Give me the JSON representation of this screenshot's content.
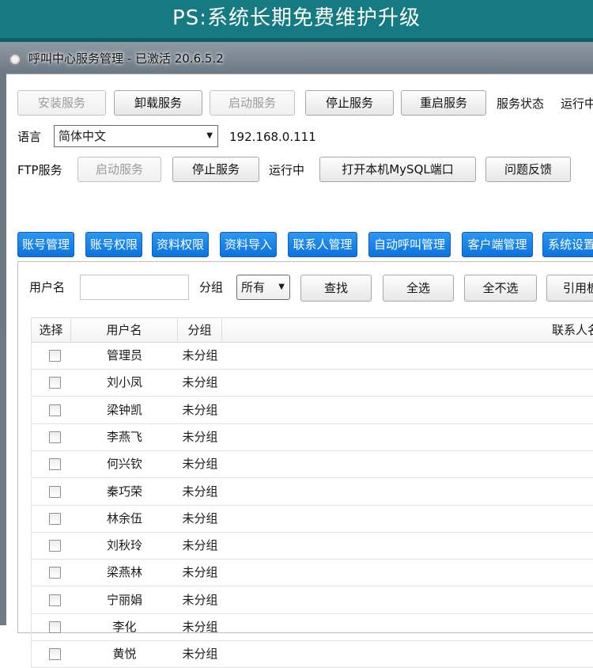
{
  "banner": {
    "text": "PS:系统长期免费维护升级"
  },
  "window": {
    "title": "呼叫中心服务管理 - 已激活  20.6.5.2"
  },
  "toolbar": {
    "install_label": "安装服务",
    "uninstall_label": "卸载服务",
    "start_label": "启动服务",
    "stop_label": "停止服务",
    "restart_label": "重启服务",
    "status_label": "服务状态",
    "status_value": "运行中"
  },
  "language": {
    "label": "语言",
    "selected": "简体中文",
    "ip": "192.168.0.111"
  },
  "ftp": {
    "label": "FTP服务",
    "start_label": "启动服务",
    "stop_label": "停止服务",
    "status_value": "运行中",
    "mysql_label": "打开本机MySQL端口",
    "feedback_label": "问题反馈"
  },
  "tabs": [
    "账号管理",
    "账号权限",
    "资料权限",
    "资料导入",
    "联系人管理",
    "自动呼叫管理",
    "客户端管理",
    "系统设置"
  ],
  "filter": {
    "username_label": "用户名",
    "username_value": "",
    "group_label": "分组",
    "group_selected": "所有",
    "search_label": "查找",
    "select_all_label": "全选",
    "select_none_label": "全不选",
    "reference_label": "引用板"
  },
  "table": {
    "columns": [
      "选择",
      "用户名",
      "分组",
      "联系人名"
    ],
    "rows": [
      {
        "name": "管理员",
        "group": "未分组"
      },
      {
        "name": "刘小凤",
        "group": "未分组"
      },
      {
        "name": "梁钟凯",
        "group": "未分组"
      },
      {
        "name": "李燕飞",
        "group": "未分组"
      },
      {
        "name": "何兴钦",
        "group": "未分组"
      },
      {
        "name": "秦巧荣",
        "group": "未分组"
      },
      {
        "name": "林余伍",
        "group": "未分组"
      },
      {
        "name": "刘秋玲",
        "group": "未分组"
      },
      {
        "name": "梁燕林",
        "group": "未分组"
      },
      {
        "name": "宁丽娟",
        "group": "未分组"
      },
      {
        "name": "李化",
        "group": "未分组"
      },
      {
        "name": "黄悦",
        "group": "未分组"
      }
    ]
  },
  "colors": {
    "banner": "#157a82",
    "tab": "#1583e8"
  }
}
